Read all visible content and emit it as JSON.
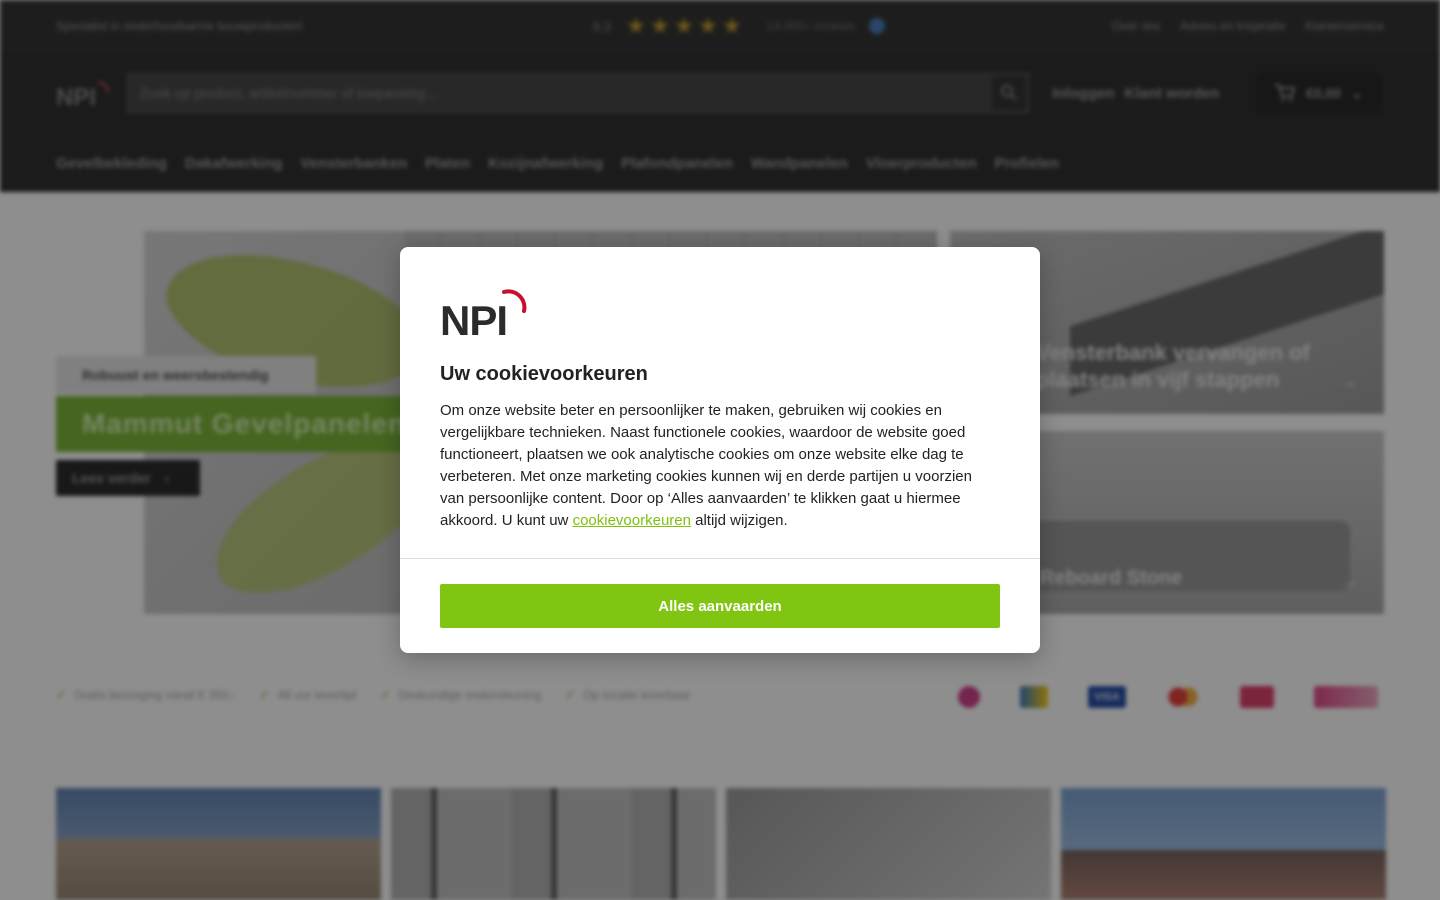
{
  "topbar": {
    "tagline": "Specialist in onderhoudsarme bouwproducten!",
    "rating_score": "9,3",
    "stars": 5,
    "review_count": "14.000+ reviews",
    "links": [
      "Over ons",
      "Advies en Inspiratie",
      "Klantenservice"
    ]
  },
  "header": {
    "search_placeholder": "Zoek op product, artikelnummer of toepassing...",
    "login": "Inloggen",
    "register": "Klant worden",
    "cart_total": "€0,00"
  },
  "nav": {
    "items": [
      "Gevelbekleding",
      "Dakafwerking",
      "Vensterbanken",
      "Platen",
      "Kozijnafwerking",
      "Plafondpanelen",
      "Wandpanelen",
      "Vloerproducten",
      "Profielen"
    ]
  },
  "hero": {
    "kicker": "Robuust en weersbestendig",
    "title": "Mammut Gevelpanelen",
    "cta": "Lees verder"
  },
  "cards": {
    "card_a": "Vensterbank vervangen of plaatsen in vijf stappen",
    "card_b": "Reboard Stone"
  },
  "usps": [
    "Gratis bezorging vanaf € 350,-",
    "48 uur levertijd",
    "Deskundige ondersteuning",
    "Op locatie leverbaar"
  ],
  "payments": [
    "iDEAL",
    "Bancontact",
    "VISA",
    "Mastercard",
    "Billink",
    "in3"
  ],
  "cookie_modal": {
    "brand": "NPI",
    "title": "Uw cookievoorkeuren",
    "body_before_link": "Om onze website beter en persoonlijker te maken, gebruiken wij cookies en vergelijkbare technieken. Naast functionele cookies, waardoor de website goed functioneert, plaatsen we ook analytische cookies om onze website elke dag te verbeteren. Met onze marketing cookies kunnen wij en derde partijen u voorzien van persoonlijke content. Door op ‘Alles aanvaarden’ te klikken gaat u hiermee akkoord. U kunt uw ",
    "link_text": "cookievoorkeuren",
    "body_after_link": " altijd wijzigen.",
    "accept_label": "Alles aanvaarden"
  },
  "colors": {
    "accent_green": "#80c511",
    "brand_red": "#c8102e",
    "brand_dark": "#2b2b2b"
  }
}
